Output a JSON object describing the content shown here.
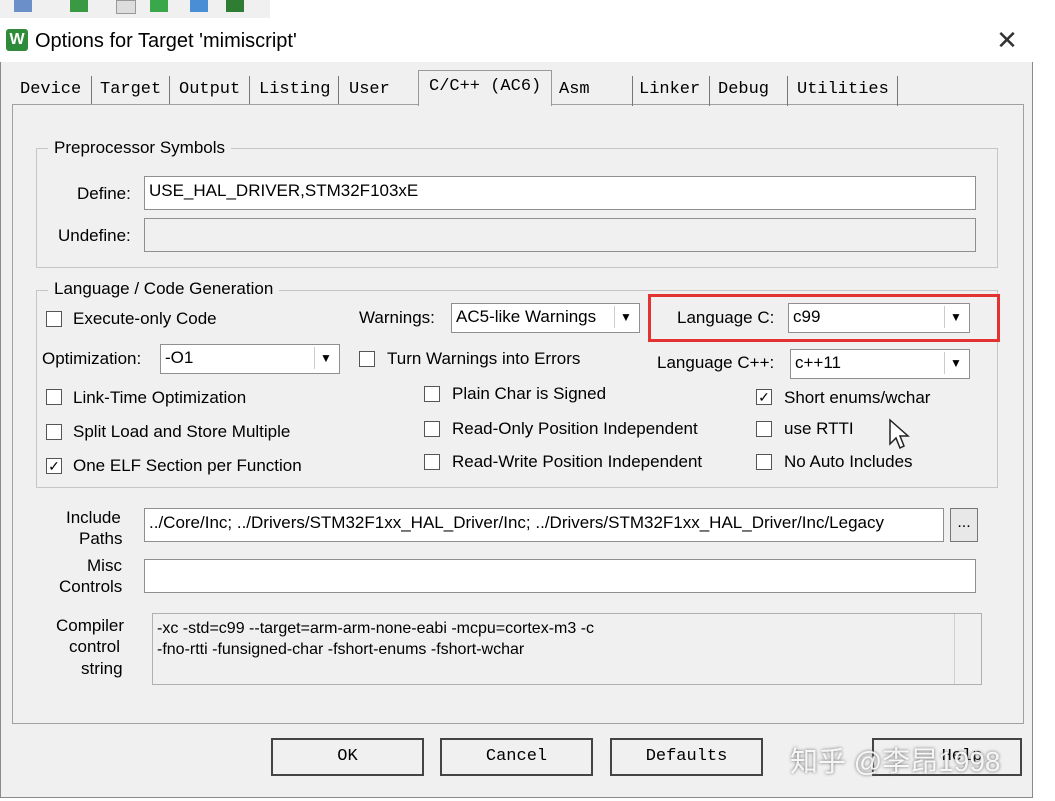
{
  "window": {
    "title": "Options for Target 'mimiscript'",
    "close_glyph": "✕"
  },
  "tabs": [
    {
      "label": "Device"
    },
    {
      "label": "Target"
    },
    {
      "label": "Output"
    },
    {
      "label": "Listing"
    },
    {
      "label": "User"
    },
    {
      "label": "C/C++ (AC6)"
    },
    {
      "label": "Asm"
    },
    {
      "label": "Linker"
    },
    {
      "label": "Debug"
    },
    {
      "label": "Utilities"
    }
  ],
  "active_tab": "C/C++ (AC6)",
  "preprocessor": {
    "legend": "Preprocessor Symbols",
    "define_label": "Define:",
    "define_value": "USE_HAL_DRIVER,STM32F103xE",
    "undefine_label": "Undefine:",
    "undefine_value": ""
  },
  "language": {
    "legend": "Language / Code Generation",
    "execute_only": {
      "label": "Execute-only Code",
      "checked": false
    },
    "warnings_label": "Warnings:",
    "warnings_value": "AC5-like Warnings",
    "language_c_label": "Language C:",
    "language_c_value": "c99",
    "optimization_label": "Optimization:",
    "optimization_value": "-O1",
    "turn_warnings": {
      "label": "Turn Warnings into Errors",
      "checked": false
    },
    "language_cpp_label": "Language C++:",
    "language_cpp_value": "c++11",
    "link_time": {
      "label": "Link-Time Optimization",
      "checked": false
    },
    "plain_char": {
      "label": "Plain Char is Signed",
      "checked": false
    },
    "short_enums": {
      "label": "Short enums/wchar",
      "checked": true
    },
    "split_load": {
      "label": "Split Load and Store Multiple",
      "checked": false
    },
    "ro_pi": {
      "label": "Read-Only Position Independent",
      "checked": false
    },
    "use_rtti": {
      "label": "use RTTI",
      "checked": false
    },
    "one_elf": {
      "label": "One ELF Section per Function",
      "checked": true
    },
    "rw_pi": {
      "label": "Read-Write Position Independent",
      "checked": false
    },
    "no_auto_includes": {
      "label": "No Auto Includes",
      "checked": false
    }
  },
  "include": {
    "label_line1": "Include",
    "label_line2": "Paths",
    "value": "../Core/Inc; ../Drivers/STM32F1xx_HAL_Driver/Inc; ../Drivers/STM32F1xx_HAL_Driver/Inc/Legacy",
    "browse_label": "..."
  },
  "misc": {
    "label_line1": "Misc",
    "label_line2": "Controls",
    "value": ""
  },
  "compiler": {
    "label_line1": "Compiler",
    "label_line2": "control",
    "label_line3": "string",
    "line1": "-xc -std=c99 --target=arm-arm-none-eabi -mcpu=cortex-m3 -c",
    "line2": "-fno-rtti -funsigned-char -fshort-enums -fshort-wchar"
  },
  "buttons": {
    "ok": "OK",
    "cancel": "Cancel",
    "defaults": "Defaults",
    "help": "Help"
  },
  "watermark": "知乎 @李昂1998",
  "colors": {
    "highlight": "#e33232",
    "dialog_bg": "#f0f0f0",
    "app_icon": "#2e8b3a"
  },
  "check_glyph": "✓",
  "dropdown_glyph": "▼"
}
